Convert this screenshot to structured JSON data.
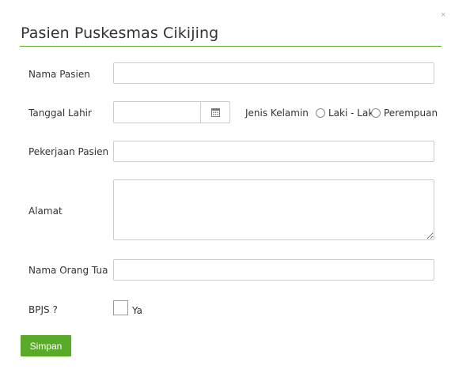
{
  "dialog": {
    "title": "Pasien Puskesmas Cikijing",
    "close_label": "×"
  },
  "form": {
    "nama_pasien": {
      "label": "Nama Pasien",
      "value": "",
      "placeholder": ""
    },
    "tanggal_lahir": {
      "label": "Tanggal Lahir",
      "value": "",
      "placeholder": ""
    },
    "jenis_kelamin": {
      "label": "Jenis Kelamin",
      "options": [
        "Laki - Laki",
        "Perempuan"
      ],
      "selected": null
    },
    "pekerjaan_pasien": {
      "label": "Pekerjaan Pasien",
      "value": "",
      "placeholder": ""
    },
    "alamat": {
      "label": "Alamat",
      "value": "",
      "placeholder": ""
    },
    "nama_orang_tua": {
      "label": "Nama Orang Tua",
      "value": "",
      "placeholder": ""
    },
    "bpjs": {
      "label": "BPJS ?",
      "checkbox_label": "Ya",
      "checked": false
    }
  },
  "actions": {
    "save_label": "Simpan",
    "save_color": "#5aaa2a"
  },
  "colors": {
    "accent_rule": "#5aa832"
  },
  "icons": {
    "calendar": "calendar-icon",
    "close": "close-icon"
  }
}
